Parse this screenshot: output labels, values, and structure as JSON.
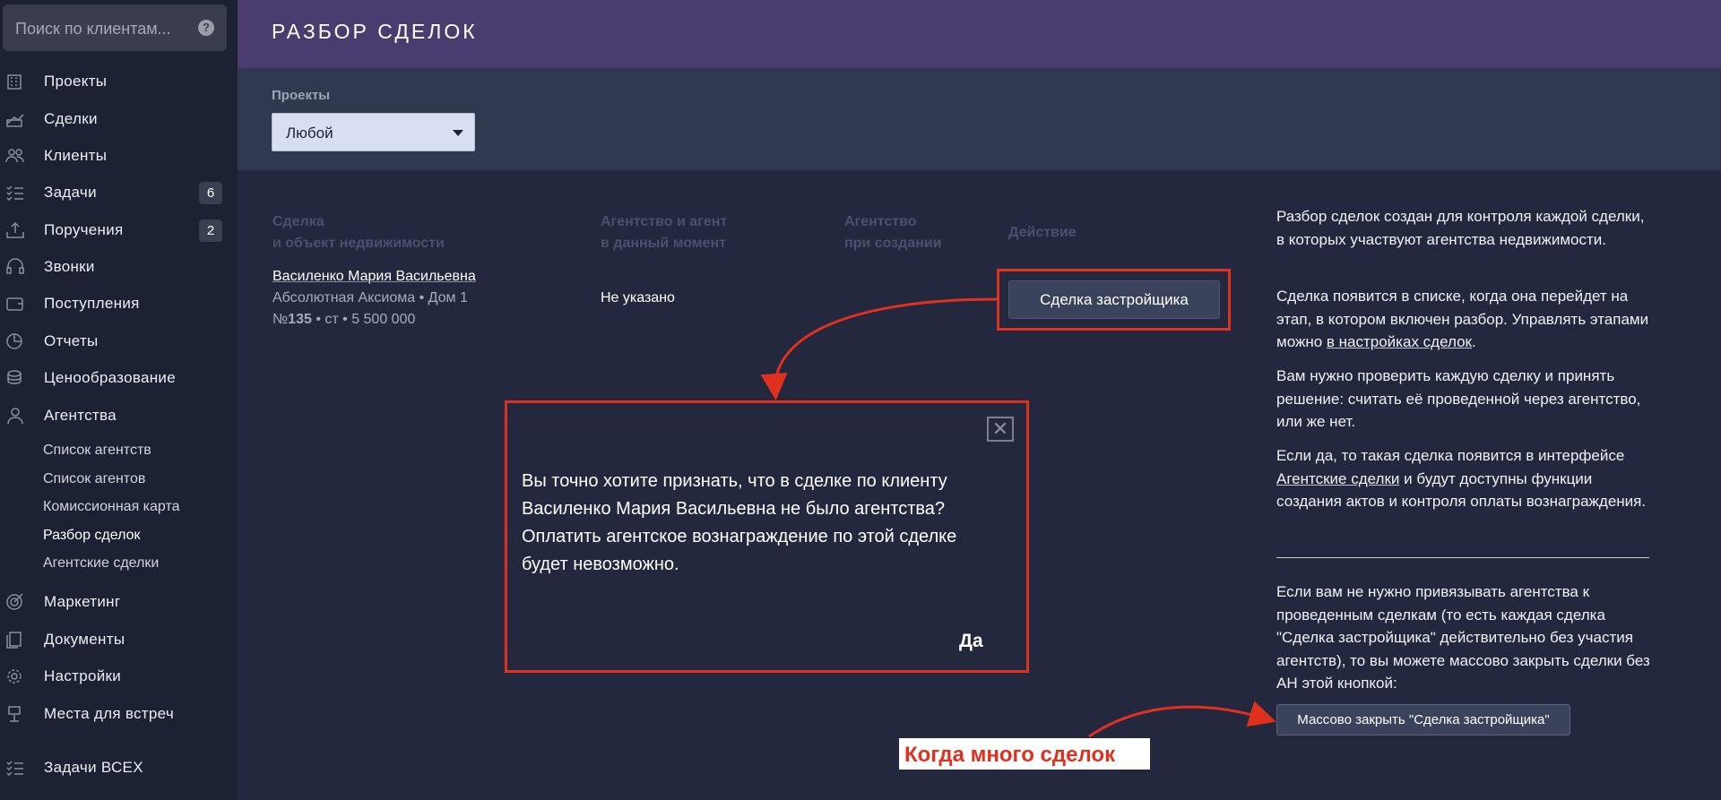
{
  "search": {
    "placeholder": "Поиск по клиентам...",
    "help_icon": "?"
  },
  "sidebar": {
    "items": [
      {
        "label": "Проекты",
        "icon": "building-icon"
      },
      {
        "label": "Сделки",
        "icon": "deals-icon"
      },
      {
        "label": "Клиенты",
        "icon": "users-icon"
      },
      {
        "label": "Задачи",
        "icon": "tasks-icon",
        "badge": "6"
      },
      {
        "label": "Поручения",
        "icon": "assignments-icon",
        "badge": "2"
      },
      {
        "label": "Звонки",
        "icon": "headset-icon"
      },
      {
        "label": "Поступления",
        "icon": "wallet-icon"
      },
      {
        "label": "Отчеты",
        "icon": "pie-chart-icon"
      },
      {
        "label": "Ценообразование",
        "icon": "coins-icon"
      },
      {
        "label": "Агентства",
        "icon": "agent-icon"
      }
    ],
    "sub_items": [
      {
        "label": "Список агентств"
      },
      {
        "label": "Список агентов"
      },
      {
        "label": "Комиссионная карта"
      },
      {
        "label": "Разбор сделок",
        "active": true
      },
      {
        "label": "Агентские сделки"
      }
    ],
    "items2": [
      {
        "label": "Маркетинг",
        "icon": "target-icon"
      },
      {
        "label": "Документы",
        "icon": "documents-icon"
      },
      {
        "label": "Настройки",
        "icon": "gear-icon"
      },
      {
        "label": "Места для встреч",
        "icon": "meeting-icon"
      },
      {
        "label": "Задачи ВСЕХ",
        "icon": "tasks-icon"
      }
    ]
  },
  "header": {
    "title": "РАЗБОР СДЕЛОК"
  },
  "filter": {
    "label": "Проекты",
    "value": "Любой"
  },
  "table": {
    "headers": [
      {
        "line1": "Сделка",
        "line2": "и объект недвижимости"
      },
      {
        "line1": "Агентство и агент",
        "line2": "в данный момент"
      },
      {
        "line1": "Агентство",
        "line2": "при создании"
      },
      {
        "line1": "Действие",
        "line2": ""
      }
    ],
    "row": {
      "client": "Василенко Мария Васильевна",
      "object": "Абсолютная Аксиома • Дом 1",
      "num_prefix": "№",
      "num": "135",
      "num_suffix": " • ст • 5 500 000",
      "agency": "Не указано",
      "action": "Сделка застройщика"
    }
  },
  "modal": {
    "message": "Вы точно хотите признать, что в сделке по клиенту Василенко Мария Васильевна не было агентства? Оплатить агентское вознаграждение по этой сделке будет невозможно.",
    "confirm": "Да",
    "close": "✕"
  },
  "info": {
    "p1": "Разбор сделок создан для контроля каждой сделки, в которых участвуют агентства недвижимости.",
    "p2_a": "Сделка появится в списке, когда она перейдет на этап, в котором включен разбор. Управлять этапами можно ",
    "p2_link": "в настройках сделок",
    "p2_b": ".",
    "p3": "Вам нужно проверить каждую сделку и принять решение: считать её проведенной через агентство, или же нет.",
    "p4_a": "Если да, то такая сделка появится в интерфейсе ",
    "p4_link": "Агентские сделки",
    "p4_b": " и будут доступны функции создания актов и контроля оплаты вознаграждения.",
    "p5": "Если вам не нужно привязывать агентства к проведенным сделкам (то есть каждая сделка \"Сделка застройщика\" действительно без участия агентств), то вы можете массово закрыть сделки без АН этой кнопкой:",
    "mass_button": "Массово закрыть \"Сделка застройщика\""
  },
  "callout": "Когда много сделок",
  "colors": {
    "annotation_red": "#e0301e",
    "header": "#4a3c6e",
    "background": "#23283f",
    "sidebar": "#1d2134"
  }
}
